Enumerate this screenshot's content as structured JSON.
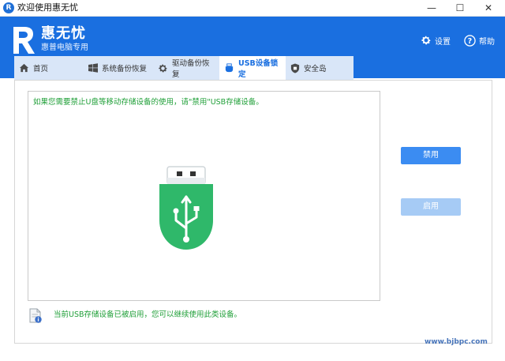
{
  "window": {
    "title": "欢迎使用惠无忧",
    "app_icon_letter": "R",
    "minimize": "—",
    "maximize": "☐",
    "close": "✕"
  },
  "header": {
    "brand_name": "惠无忧",
    "brand_sub": "惠普电脑专用",
    "settings_label": "设置",
    "help_label": "帮助"
  },
  "tabs": [
    {
      "label": "首页",
      "icon": "home-icon"
    },
    {
      "label": "系统备份恢复",
      "icon": "windows-icon"
    },
    {
      "label": "驱动备份恢复",
      "icon": "gear-icon"
    },
    {
      "label": "USB设备锁定",
      "icon": "usb-icon",
      "active": true
    },
    {
      "label": "安全岛",
      "icon": "shield-icon"
    }
  ],
  "main": {
    "hint": "如果您需要禁止U盘等移动存储设备的使用，请\"禁用\"USB存储设备。",
    "disable_label": "禁用",
    "enable_label": "启用",
    "status": "当前USB存储设备已被启用，您可以继续使用此类设备。"
  },
  "watermark": "www.bjbpc.com",
  "colors": {
    "header_blue": "#1a6fe0",
    "usb_green": "#2fb86a",
    "hint_green": "#22a03a",
    "button_blue": "#3b8cf2",
    "button_disabled": "#a6cbf5"
  }
}
